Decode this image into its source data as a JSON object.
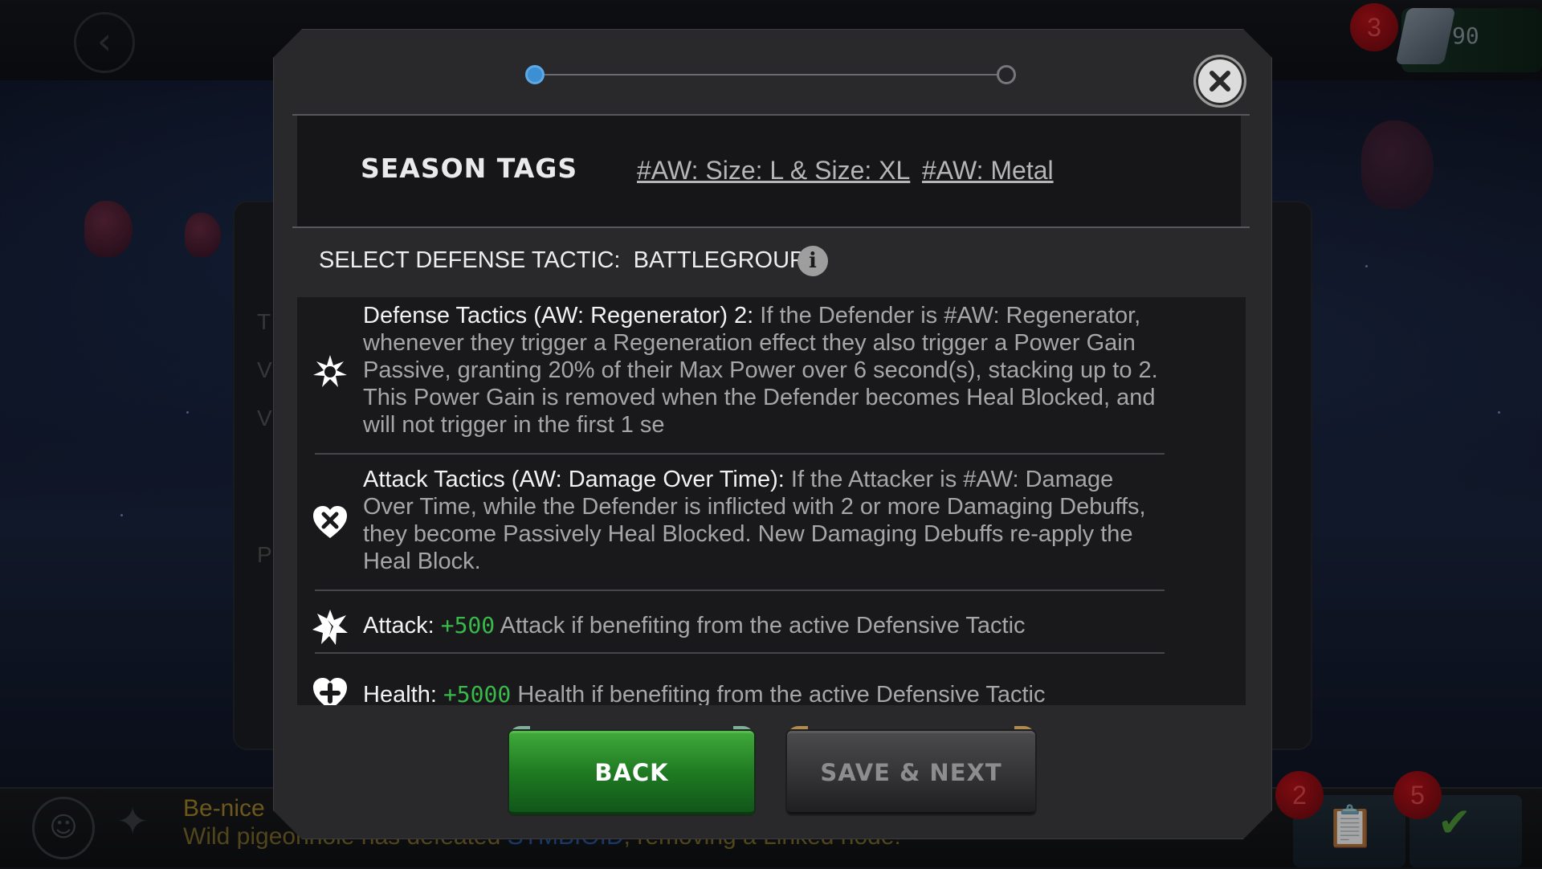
{
  "background": {
    "ticker_line1": "Be-nice",
    "ticker_line2_prefix": "Wild pigeonhole has defeated",
    "ticker_line2_name": "STMBIOID",
    "ticker_line2_suffix": ", removing a Linked node!",
    "currency_value": "90",
    "badges": {
      "top_right": "3",
      "tray_left": "2",
      "tray_right": "5"
    },
    "side_letters": [
      "T",
      "V",
      "V",
      "P"
    ]
  },
  "modal": {
    "progress": {
      "current_step": 1,
      "total_steps": 2
    },
    "season_tags": {
      "title": "SEASON TAGS",
      "tags": [
        "#AW: Size: L & Size: XL",
        "#AW: Metal"
      ]
    },
    "defense_tactic": {
      "label": "SELECT DEFENSE TACTIC:",
      "battlegroup": "BATTLEGROUP 1"
    },
    "items": [
      {
        "icon": "regenerator-icon",
        "lead": "Defense Tactics (AW: Regenerator) 2:",
        "text": "If the Defender is #AW: Regenerator, whenever they trigger a Regeneration effect they also trigger a Power Gain Passive, granting 20% of their Max Power over 6 second(s), stacking up to 2. This Power Gain is removed when the Defender becomes Heal Blocked, and will not trigger in the first 1 se"
      },
      {
        "icon": "heal-block-icon",
        "lead": "Attack Tactics (AW: Damage Over Time):",
        "text": "If the Attacker is #AW: Damage Over Time, while the Defender is inflicted with 2 or more Damaging Debuffs, they become Passively Heal Blocked. New Damaging Debuffs re-apply the Heal Block."
      },
      {
        "icon": "attack-icon",
        "lead": "Attack:",
        "value": "+500",
        "text": "Attack if benefiting from the active Defensive Tactic"
      },
      {
        "icon": "health-icon",
        "lead": "Health:",
        "value": "+5000",
        "text": "Health if benefiting from the active Defensive Tactic"
      }
    ],
    "buttons": {
      "back": "BACK",
      "save_next": "SAVE & NEXT"
    }
  },
  "colors": {
    "accent_blue": "#3c8fd2",
    "positive_green": "#38b94a",
    "back_button": "#1f7a22",
    "modal_bg": "#29292b"
  }
}
